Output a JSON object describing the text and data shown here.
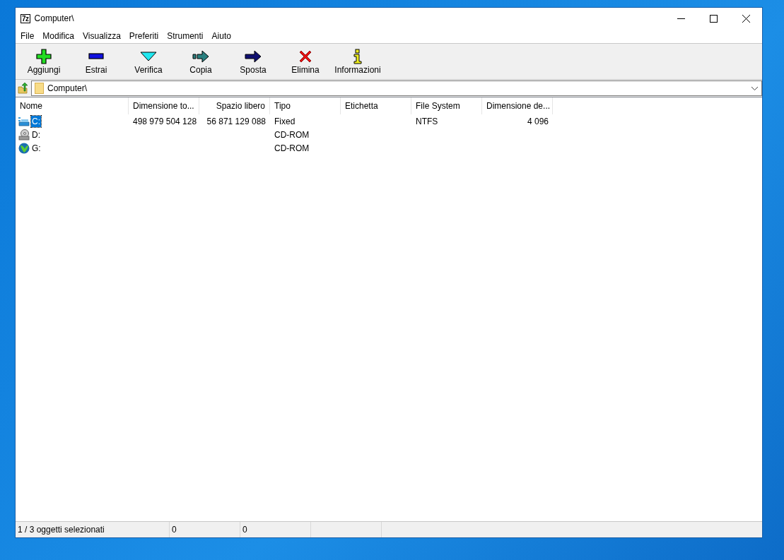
{
  "window": {
    "app_icon": "7z",
    "title": "Computer\\"
  },
  "menu": [
    "File",
    "Modifica",
    "Visualizza",
    "Preferiti",
    "Strumenti",
    "Aiuto"
  ],
  "toolbar": [
    "Aggiungi",
    "Estrai",
    "Verifica",
    "Copia",
    "Sposta",
    "Elimina",
    "Informazioni"
  ],
  "address": {
    "value": "Computer\\"
  },
  "table": {
    "columns": [
      "Nome",
      "Dimensione to...",
      "Spazio libero",
      "Tipo",
      "Etichetta",
      "File System",
      "Dimensione de..."
    ],
    "rows": [
      {
        "selected": true,
        "cells": [
          "C:",
          "498 979 504 128",
          "56 871 129 088",
          "Fixed",
          "",
          "NTFS",
          "4 096"
        ]
      },
      {
        "selected": false,
        "cells": [
          "D:",
          "",
          "",
          "CD-ROM",
          "",
          "",
          ""
        ]
      },
      {
        "selected": false,
        "cells": [
          "G:",
          "",
          "",
          "CD-ROM",
          "",
          "",
          ""
        ]
      }
    ]
  },
  "status_bar": [
    "1 / 3 oggetti selezionati",
    "0",
    "0"
  ]
}
